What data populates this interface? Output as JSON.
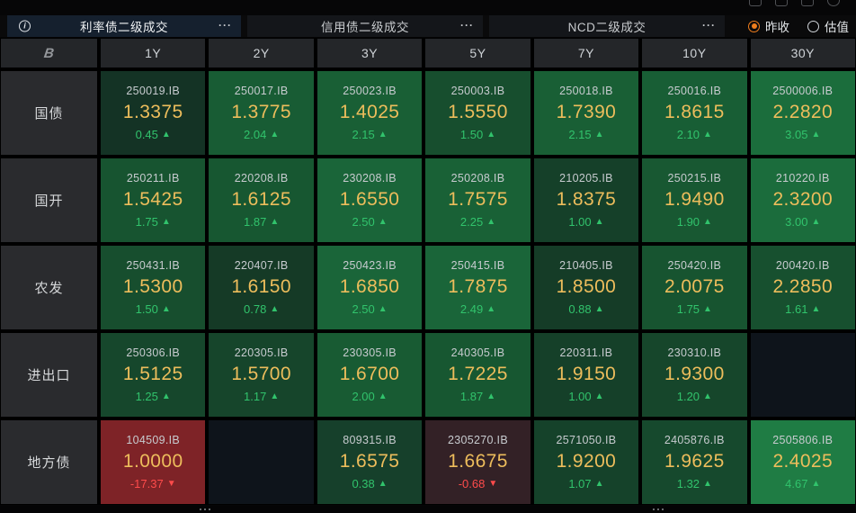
{
  "icons": {
    "info": "i",
    "more": "···",
    "up": "▲",
    "down": "▼",
    "logo": "B"
  },
  "tabs": [
    {
      "label": "利率债二级成交",
      "selected": true
    },
    {
      "label": "信用债二级成交",
      "selected": false
    },
    {
      "label": "NCD二级成交",
      "selected": false
    }
  ],
  "price_mode": {
    "options": [
      {
        "label": "昨收",
        "selected": true
      },
      {
        "label": "估值",
        "selected": false
      }
    ]
  },
  "colors": {
    "up_text": "#31c36c",
    "down_text": "#ff4b4b",
    "value_text": "#edbd5c",
    "accent_orange": "#ef7d1d"
  },
  "grid": {
    "columns": [
      "1Y",
      "2Y",
      "3Y",
      "5Y",
      "7Y",
      "10Y",
      "30Y"
    ],
    "rows": [
      {
        "key": "treasury",
        "label": "国债",
        "cells": [
          {
            "code": "250019.IB",
            "value": "1.3375",
            "change": "0.45",
            "dir": "up",
            "bg": "#143325"
          },
          {
            "code": "250017.IB",
            "value": "1.3775",
            "change": "2.04",
            "dir": "up",
            "bg": "#185c34"
          },
          {
            "code": "250023.IB",
            "value": "1.4025",
            "change": "2.15",
            "dir": "up",
            "bg": "#195f35"
          },
          {
            "code": "250003.IB",
            "value": "1.5550",
            "change": "1.50",
            "dir": "up",
            "bg": "#174e2e"
          },
          {
            "code": "250018.IB",
            "value": "1.7390",
            "change": "2.15",
            "dir": "up",
            "bg": "#195f35"
          },
          {
            "code": "250016.IB",
            "value": "1.8615",
            "change": "2.10",
            "dir": "up",
            "bg": "#185e35"
          },
          {
            "code": "2500006.IB",
            "value": "2.2820",
            "change": "3.05",
            "dir": "up",
            "bg": "#1b6d3c"
          }
        ]
      },
      {
        "key": "cdb",
        "label": "国开",
        "cells": [
          {
            "code": "250211.IB",
            "value": "1.5425",
            "change": "1.75",
            "dir": "up",
            "bg": "#175430"
          },
          {
            "code": "220208.IB",
            "value": "1.6125",
            "change": "1.87",
            "dir": "up",
            "bg": "#175731"
          },
          {
            "code": "230208.IB",
            "value": "1.6550",
            "change": "2.50",
            "dir": "up",
            "bg": "#1a6539"
          },
          {
            "code": "250208.IB",
            "value": "1.7575",
            "change": "2.25",
            "dir": "up",
            "bg": "#196136"
          },
          {
            "code": "210205.IB",
            "value": "1.8375",
            "change": "1.00",
            "dir": "up",
            "bg": "#154029"
          },
          {
            "code": "250215.IB",
            "value": "1.9490",
            "change": "1.90",
            "dir": "up",
            "bg": "#185832"
          },
          {
            "code": "210220.IB",
            "value": "2.3200",
            "change": "3.00",
            "dir": "up",
            "bg": "#1b6c3c"
          }
        ]
      },
      {
        "key": "adbc",
        "label": "农发",
        "cells": [
          {
            "code": "250431.IB",
            "value": "1.5300",
            "change": "1.50",
            "dir": "up",
            "bg": "#174e2e"
          },
          {
            "code": "220407.IB",
            "value": "1.6150",
            "change": "0.78",
            "dir": "up",
            "bg": "#153a26"
          },
          {
            "code": "250423.IB",
            "value": "1.6850",
            "change": "2.50",
            "dir": "up",
            "bg": "#1a6539"
          },
          {
            "code": "250415.IB",
            "value": "1.7875",
            "change": "2.49",
            "dir": "up",
            "bg": "#1a6539"
          },
          {
            "code": "210405.IB",
            "value": "1.8500",
            "change": "0.88",
            "dir": "up",
            "bg": "#153c27"
          },
          {
            "code": "250420.IB",
            "value": "2.0075",
            "change": "1.75",
            "dir": "up",
            "bg": "#175430"
          },
          {
            "code": "200420.IB",
            "value": "2.2850",
            "change": "1.61",
            "dir": "up",
            "bg": "#17502f"
          }
        ]
      },
      {
        "key": "exim",
        "label": "进出口",
        "cells": [
          {
            "code": "250306.IB",
            "value": "1.5125",
            "change": "1.25",
            "dir": "up",
            "bg": "#16472c"
          },
          {
            "code": "220305.IB",
            "value": "1.5700",
            "change": "1.17",
            "dir": "up",
            "bg": "#16452b"
          },
          {
            "code": "230305.IB",
            "value": "1.6700",
            "change": "2.00",
            "dir": "up",
            "bg": "#185b33"
          },
          {
            "code": "240305.IB",
            "value": "1.7225",
            "change": "1.87",
            "dir": "up",
            "bg": "#175731"
          },
          {
            "code": "220311.IB",
            "value": "1.9150",
            "change": "1.00",
            "dir": "up",
            "bg": "#154029"
          },
          {
            "code": "230310.IB",
            "value": "1.9300",
            "change": "1.20",
            "dir": "up",
            "bg": "#16462b"
          },
          null
        ]
      },
      {
        "key": "lgb",
        "label": "地方债",
        "cells": [
          {
            "code": "104509.IB",
            "value": "1.0000",
            "change": "-17.37",
            "dir": "down",
            "bg": "#7e2327"
          },
          null,
          {
            "code": "809315.IB",
            "value": "1.6575",
            "change": "0.38",
            "dir": "up",
            "bg": "#16402b"
          },
          {
            "code": "2305270.IB",
            "value": "1.6675",
            "change": "-0.68",
            "dir": "down",
            "bg": "#332126"
          },
          {
            "code": "2571050.IB",
            "value": "1.9200",
            "change": "1.07",
            "dir": "up",
            "bg": "#15422a"
          },
          {
            "code": "2405876.IB",
            "value": "1.9625",
            "change": "1.32",
            "dir": "up",
            "bg": "#16492d"
          },
          {
            "code": "2505806.IB",
            "value": "2.4025",
            "change": "4.67",
            "dir": "up",
            "bg": "#1f7c44"
          }
        ]
      }
    ]
  }
}
